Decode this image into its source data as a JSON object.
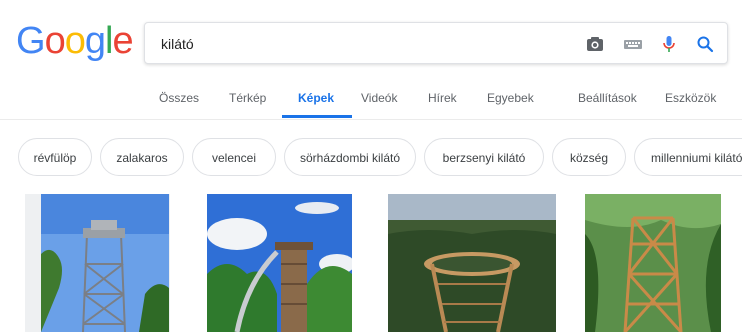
{
  "logo": {
    "letters": [
      "G",
      "o",
      "o",
      "g",
      "l",
      "e"
    ],
    "colors": [
      "#4285f4",
      "#ea4335",
      "#fbbc05",
      "#4285f4",
      "#34a853",
      "#ea4335"
    ]
  },
  "search": {
    "query": "kilátó"
  },
  "search_icons": [
    "camera-icon",
    "keyboard-icon",
    "microphone-icon",
    "search-icon"
  ],
  "nav": {
    "tabs": [
      "Összes",
      "Térkép",
      "Képek",
      "Videók",
      "Hírek",
      "Egyebek"
    ],
    "active": "Képek",
    "settings": "Beállítások",
    "tools": "Eszközök"
  },
  "chips": [
    "révfülöp",
    "zalakaros",
    "velencei",
    "sörházdombi kilátó",
    "berzsenyi kilátó",
    "község",
    "millenniumi kilátó"
  ],
  "colors": {
    "accent": "#1a73e8",
    "text_secondary": "#5f6368"
  }
}
